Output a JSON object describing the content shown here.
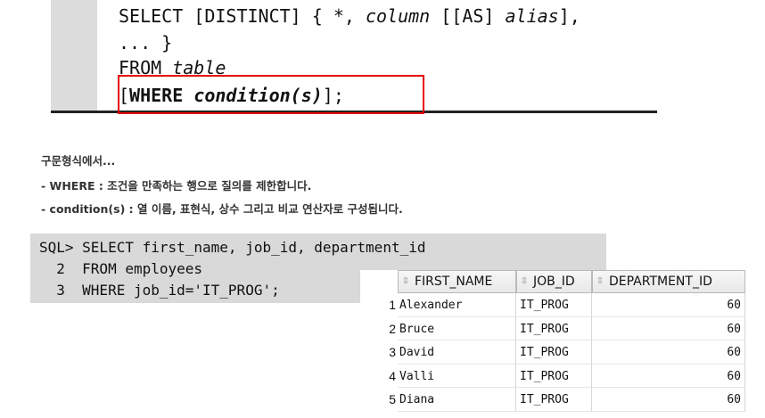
{
  "syntax": {
    "line1_a": "SELECT [DISTINCT] { *, ",
    "line1_column": "column",
    "line1_b": " [[AS] ",
    "line1_alias": "alias",
    "line1_c": "],",
    "line2": "... }",
    "line3_a": "FROM ",
    "line3_table": "table",
    "line4_open": "[",
    "line4_where": "WHERE ",
    "line4_condition": "condition(s)",
    "line4_close": "];",
    "highlight_color": "#e60000"
  },
  "description": {
    "line1": "구문형식에서...",
    "line2": "- WHERE : 조건을 만족하는 행으로 질의를 제한합니다.",
    "line3": "- condition(s) : 열 이름, 표현식, 상수 그리고 비교 연산자로 구성됩니다."
  },
  "sql": {
    "line1": "SQL> SELECT first_name, job_id, department_id",
    "line2": "  2  FROM employees",
    "line3": "  3  WHERE job_id='IT_PROG';"
  },
  "result": {
    "columns": [
      "FIRST_NAME",
      "JOB_ID",
      "DEPARTMENT_ID"
    ],
    "sort_icon": "sort-icon",
    "rows": [
      {
        "num": "1",
        "first_name": "Alexander",
        "job_id": "IT_PROG",
        "department_id": "60"
      },
      {
        "num": "2",
        "first_name": "Bruce",
        "job_id": "IT_PROG",
        "department_id": "60"
      },
      {
        "num": "3",
        "first_name": "David",
        "job_id": "IT_PROG",
        "department_id": "60"
      },
      {
        "num": "4",
        "first_name": "Valli",
        "job_id": "IT_PROG",
        "department_id": "60"
      },
      {
        "num": "5",
        "first_name": "Diana",
        "job_id": "IT_PROG",
        "department_id": "60"
      }
    ]
  }
}
